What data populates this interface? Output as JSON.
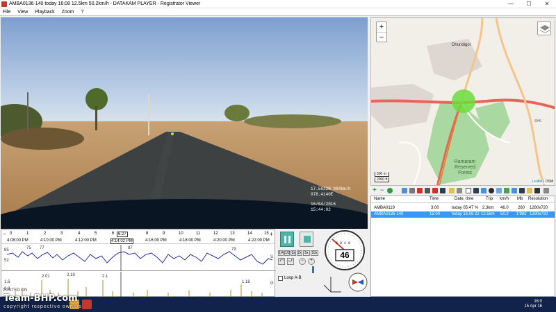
{
  "window": {
    "title": "AMBA0136-140   today 16:08   12.5km   50.2km/h  -  DATAKAM PLAYER - Registrator Viewer",
    "minimize": "—",
    "maximize": "☐",
    "close": "✕"
  },
  "menu": [
    "File",
    "View",
    "Playback",
    "Zoom",
    "?"
  ],
  "video": {
    "osd_coords": "17.5632N 084km/h",
    "osd_coords2": "078.4140E",
    "osd_date": "16/04/2016",
    "osd_time": "15:44:02"
  },
  "timeline": {
    "zoom_out": "−",
    "zoom_in": "+",
    "ticks": [
      "0",
      "1",
      "2",
      "3",
      "4",
      "5",
      "6",
      "7",
      "8",
      "9",
      "10",
      "11",
      "12",
      "13",
      "14",
      "15"
    ],
    "marker": "6.27",
    "times": [
      "4:08:00 PM",
      "4:10:00 PM",
      "4:12:00 PM",
      "4:14:02 PM",
      "4:16:00 PM",
      "4:18:00 PM",
      "4:20:00 PM",
      "4:22:00 PM"
    ],
    "speed_labels": [
      "85",
      "75",
      "77",
      "87",
      "79",
      "52"
    ],
    "speed_axis": "S",
    "accel_labels": [
      "1.6",
      "0.8",
      "2.01",
      "2.19",
      "2.1",
      "1.18"
    ],
    "accel_axis": "G"
  },
  "controls": {
    "speeds": [
      "1/4",
      "1/2",
      "1x",
      "2x",
      "5x",
      "10x",
      "60x"
    ],
    "loop_label": "Loop A-B"
  },
  "gauge": {
    "speed": "46",
    "odometer": "6 0 1 0"
  },
  "map": {
    "zoom_in": "+",
    "zoom_out": "−",
    "town": "Dhundigol",
    "forest": "Ramaram Reserved Forest",
    "scale_m": "500 m",
    "scale_ft": "2000 ft",
    "attribution_link": "Leaflet",
    "attribution_osm": "| OSM",
    "road_label": "SH6"
  },
  "filelist": {
    "columns": [
      "Name",
      "Time",
      "Date, time",
      "Trip",
      "km/h",
      "Mb",
      "Resolution"
    ],
    "rows": [
      {
        "name": "AMBA0119",
        "time": "3:00",
        "date": "today 05:47 %",
        "trip": "2.3km",
        "kmh": "46.0",
        "mb": "260",
        "res": "1280x720"
      },
      {
        "name": "AMBA0136-140",
        "time": "15:00",
        "date": "today 16:08 22",
        "trip": "12.5km",
        "kmh": "50.2",
        "mb": "1'982",
        "res": "1280x720"
      }
    ]
  },
  "taskbar": {
    "time": "16:0",
    "date": "15 Apr 16"
  },
  "watermark": {
    "main": "Team-BHP.com",
    "sub": "copyright respective owners",
    "posted": "POSTED ON"
  },
  "colors": {
    "route": "#e8655a",
    "track": "#e67e22",
    "position_marker": "#6ddc3c",
    "forest": "#a9d9a0",
    "selection": "#3399ff",
    "speed_line": "#2030a0",
    "accel_bars": "#b08a2a"
  }
}
